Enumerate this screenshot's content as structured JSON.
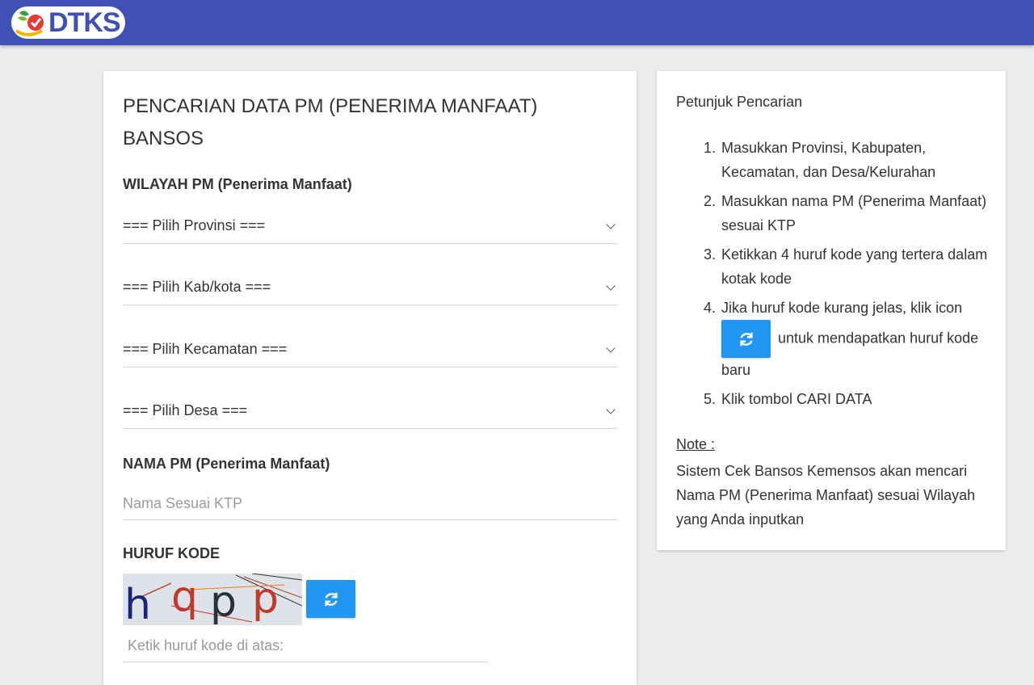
{
  "header": {
    "logo_text": "DTKS",
    "bar_color": "#3f51b5"
  },
  "form": {
    "title": "PENCARIAN DATA PM (PENERIMA MANFAAT) BANSOS",
    "wilayah_label": "WILAYAH PM (Penerima Manfaat)",
    "provinsi": "=== Pilih Provinsi ===",
    "kabkota": "=== Pilih Kab/kota ===",
    "kecamatan": "=== Pilih Kecamatan ===",
    "desa": "=== Pilih Desa ===",
    "nama_label": "NAMA PM (Penerima Manfaat)",
    "nama_placeholder": "Nama Sesuai KTP",
    "kode_label": "HURUF KODE",
    "captcha_text": "h q p p",
    "kode_placeholder": "Ketik huruf kode di atas:",
    "accent_color": "#2196f3"
  },
  "help": {
    "title": "Petunjuk Pencarian",
    "steps": [
      {
        "num": "1.",
        "text": "Masukkan Provinsi, Kabupaten, Kecamatan, dan Desa/Kelurahan"
      },
      {
        "num": "2.",
        "text": "Masukkan nama PM (Penerima Manfaat) sesuai KTP"
      },
      {
        "num": "3.",
        "text": "Ketikkan 4 huruf kode yang tertera dalam kotak kode"
      },
      {
        "num": "4.",
        "text_before": "Jika huruf kode kurang jelas, klik icon",
        "text_after": "untuk mendapatkan huruf kode baru"
      },
      {
        "num": "5.",
        "text": "Klik tombol CARI DATA"
      }
    ],
    "note_label": "Note :",
    "note_text": "Sistem Cek Bansos Kemensos akan mencari Nama PM (Penerima Manfaat) sesuai Wilayah yang Anda inputkan"
  }
}
